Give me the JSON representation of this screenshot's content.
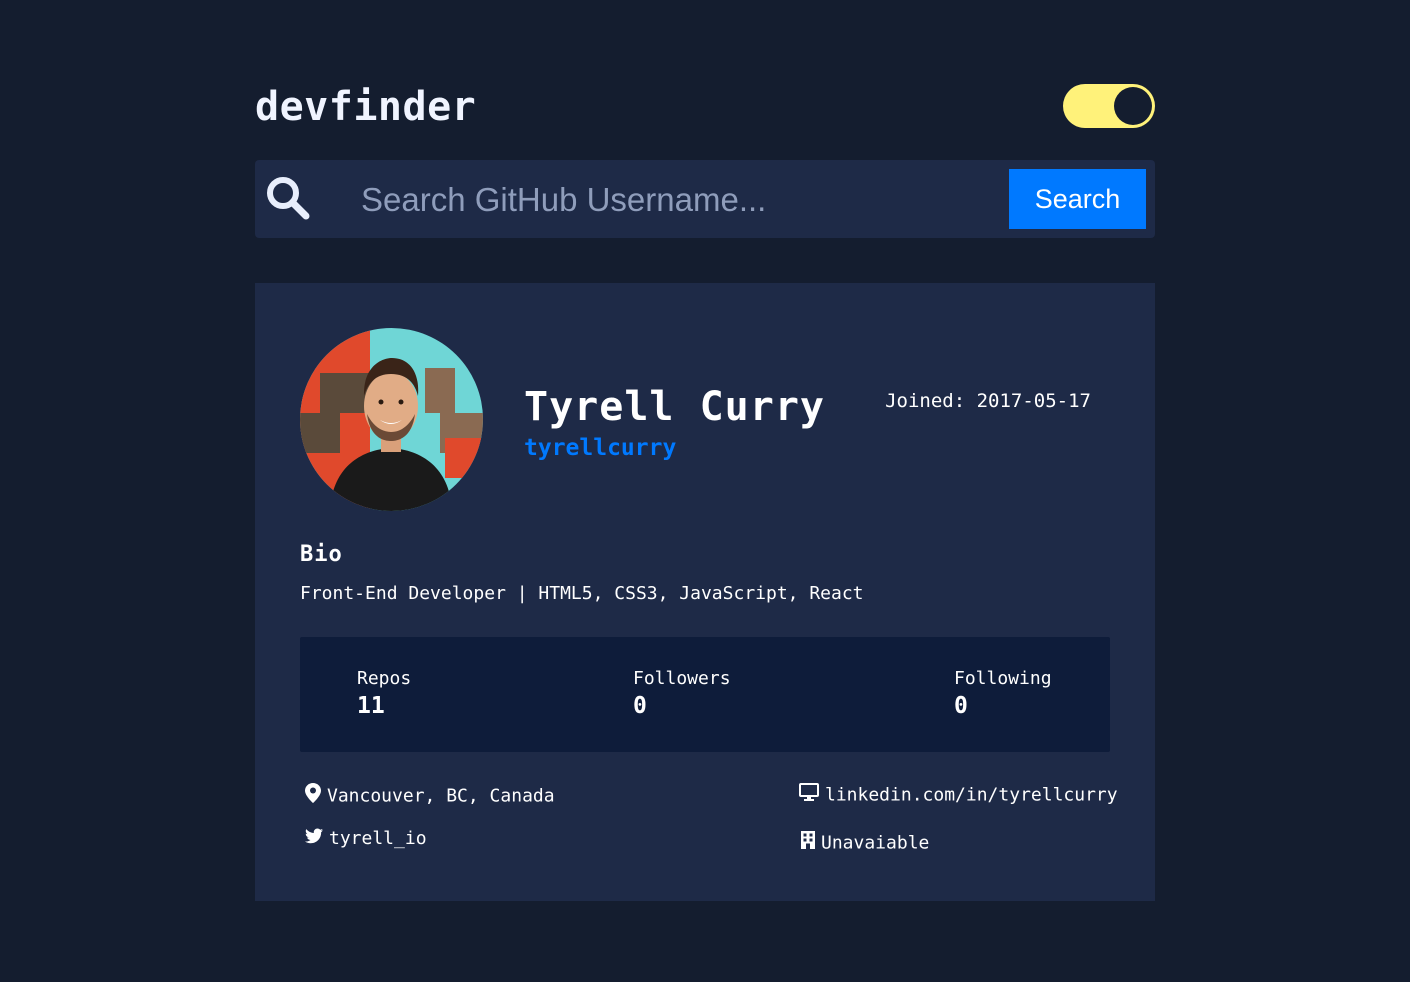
{
  "header": {
    "logo": "devfinder",
    "theme_toggle": {
      "state": "dark",
      "track_color": "#fff27a",
      "knob_color": "#141d2f"
    }
  },
  "search": {
    "placeholder": "Search GitHub Username...",
    "value": "",
    "button_label": "Search",
    "icon": "search-icon",
    "accent": "#0079ff"
  },
  "profile": {
    "avatar_icon": "avatar",
    "name": "Tyrell Curry",
    "login": "tyrellcurry",
    "joined": "Joined: 2017-05-17",
    "bio_heading": "Bio",
    "bio": "Front-End Developer | HTML5, CSS3, JavaScript, React",
    "stats": [
      {
        "label": "Repos",
        "value": "11"
      },
      {
        "label": "Followers",
        "value": "0"
      },
      {
        "label": "Following",
        "value": "0"
      }
    ],
    "links": {
      "location": {
        "icon": "location-pin-icon",
        "text": "Vancouver, BC, Canada"
      },
      "twitter": {
        "icon": "twitter-icon",
        "text": "tyrell_io"
      },
      "blog": {
        "icon": "monitor-icon",
        "text": "linkedin.com/in/tyrellcurry"
      },
      "company": {
        "icon": "building-icon",
        "text": "Unavaiable"
      }
    }
  },
  "colors": {
    "background": "#141d2f",
    "card": "#1e2a47",
    "stats_panel": "#0e1c3a",
    "link_blue": "#0079ff"
  }
}
